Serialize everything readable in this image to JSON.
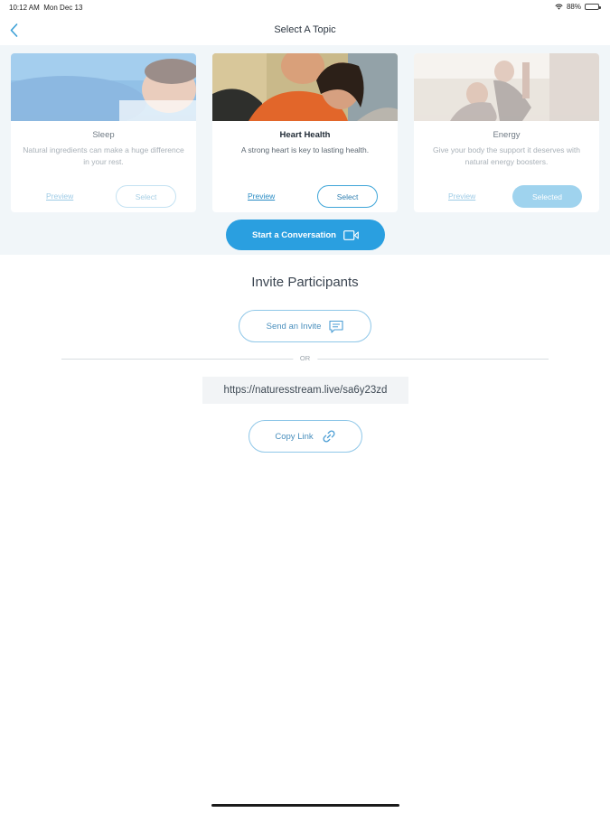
{
  "status": {
    "time": "10:12 AM",
    "date": "Mon Dec 13",
    "battery": "88%"
  },
  "nav": {
    "title": "Select A Topic"
  },
  "topics": [
    {
      "title": "Sleep",
      "description": "Natural ingredients can make a huge difference in your rest.",
      "preview_label": "Preview",
      "select_label": "Select"
    },
    {
      "title": "Heart Health",
      "description": "A strong heart is key to lasting health.",
      "preview_label": "Preview",
      "select_label": "Select"
    },
    {
      "title": "Energy",
      "description": "Give your body the support it deserves with natural energy boosters.",
      "preview_label": "Preview",
      "select_label": "Selected"
    }
  ],
  "start_button": {
    "label": "Start a Conversation"
  },
  "invite": {
    "title": "Invite Participants",
    "send_label": "Send an Invite",
    "or_label": "OR",
    "link": "https://naturesstream.live/sa6y23zd",
    "copy_label": "Copy Link"
  },
  "colors": {
    "accent": "#2a9fe0",
    "selected": "#9fd3ee",
    "panel_bg": "#f1f6f9"
  }
}
